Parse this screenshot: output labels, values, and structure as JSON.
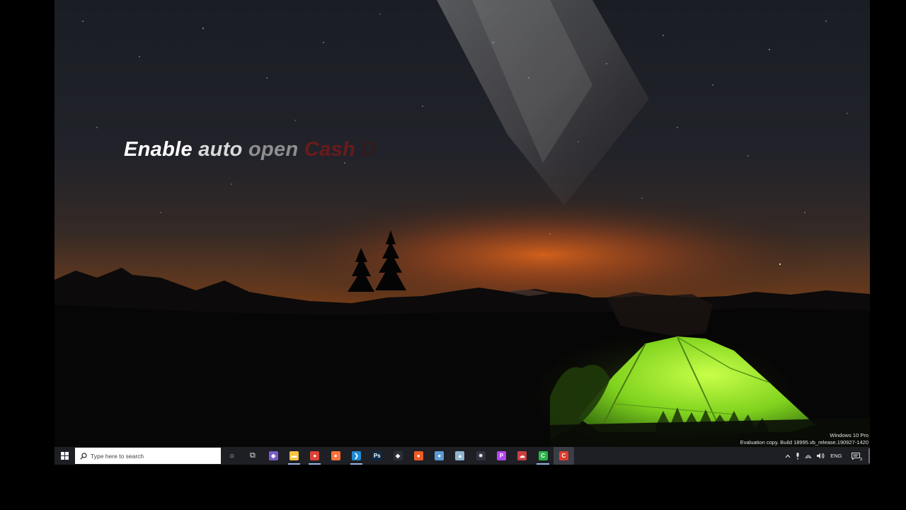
{
  "overlay": {
    "words": [
      "Enable",
      "auto",
      "open",
      "Cash",
      "D"
    ]
  },
  "watermark": {
    "edition": "Windows 10 Pro",
    "build": "Evaluation copy. Build 18995.vb_release.190927-1420"
  },
  "taskbar": {
    "search_placeholder": "Type here to search",
    "apps": [
      {
        "name": "cortana-icon",
        "glyph": "○",
        "color": "#1d1f24"
      },
      {
        "name": "task-view-icon",
        "glyph": "⧉",
        "color": "#1d1f24"
      },
      {
        "name": "visual-studio-icon",
        "glyph": "◆",
        "color": "#7b5cc4"
      },
      {
        "name": "file-explorer-icon",
        "glyph": "▬",
        "color": "#f4c542"
      },
      {
        "name": "chrome-icon",
        "glyph": "●",
        "color": "#db4437"
      },
      {
        "name": "firefox-icon",
        "glyph": "●",
        "color": "#ff7139"
      },
      {
        "name": "vscode-icon",
        "glyph": "❯",
        "color": "#1f8ad2"
      },
      {
        "name": "photoshop-icon",
        "glyph": "Ps",
        "color": "#0b2a45"
      },
      {
        "name": "git-icon",
        "glyph": "◆",
        "color": "#2a2f3a"
      },
      {
        "name": "postman-icon",
        "glyph": "●",
        "color": "#ef5b25"
      },
      {
        "name": "teams-icon",
        "glyph": "●",
        "color": "#5b9bd5"
      },
      {
        "name": "docker-icon",
        "glyph": "▲",
        "color": "#8fb4cf"
      },
      {
        "name": "electron-icon",
        "glyph": "✷",
        "color": "#2f3340"
      },
      {
        "name": "phpstorm-icon",
        "glyph": "P",
        "color": "#b345f1"
      },
      {
        "name": "cloud-app-icon",
        "glyph": "☁",
        "color": "#c94040"
      },
      {
        "name": "camtasia-green-icon",
        "glyph": "C",
        "color": "#2bb34a"
      },
      {
        "name": "camtasia-red-icon",
        "glyph": "C",
        "color": "#e03a2f"
      }
    ],
    "tray": {
      "language": "ENG",
      "notification_count": "3"
    }
  },
  "colors": {
    "taskbar_bg": "#1d1f24",
    "accent_underline": "#9ab6e6"
  }
}
